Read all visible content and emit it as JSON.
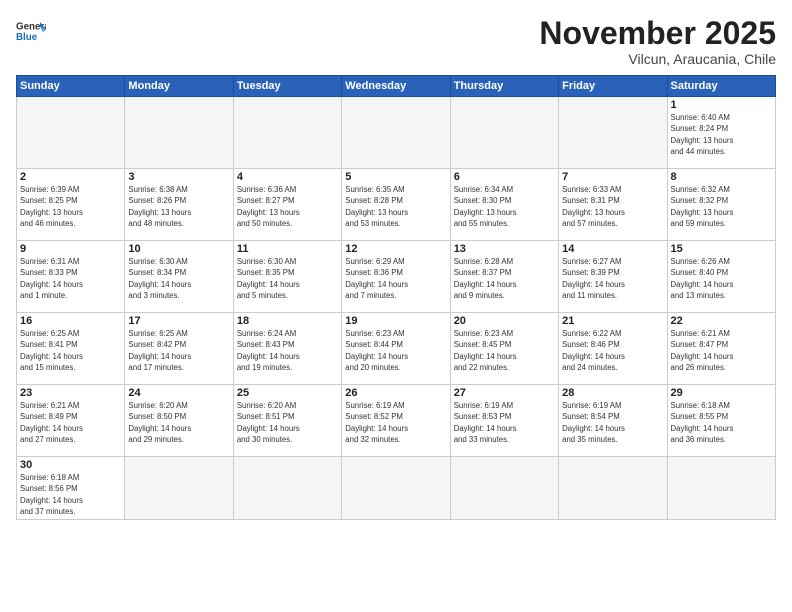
{
  "header": {
    "logo_general": "General",
    "logo_blue": "Blue",
    "month_title": "November 2025",
    "subtitle": "Vilcun, Araucania, Chile"
  },
  "weekdays": [
    "Sunday",
    "Monday",
    "Tuesday",
    "Wednesday",
    "Thursday",
    "Friday",
    "Saturday"
  ],
  "weeks": [
    [
      {
        "day": "",
        "info": ""
      },
      {
        "day": "",
        "info": ""
      },
      {
        "day": "",
        "info": ""
      },
      {
        "day": "",
        "info": ""
      },
      {
        "day": "",
        "info": ""
      },
      {
        "day": "",
        "info": ""
      },
      {
        "day": "1",
        "info": "Sunrise: 6:40 AM\nSunset: 8:24 PM\nDaylight: 13 hours\nand 44 minutes."
      }
    ],
    [
      {
        "day": "2",
        "info": "Sunrise: 6:39 AM\nSunset: 8:25 PM\nDaylight: 13 hours\nand 46 minutes."
      },
      {
        "day": "3",
        "info": "Sunrise: 6:38 AM\nSunset: 8:26 PM\nDaylight: 13 hours\nand 48 minutes."
      },
      {
        "day": "4",
        "info": "Sunrise: 6:36 AM\nSunset: 8:27 PM\nDaylight: 13 hours\nand 50 minutes."
      },
      {
        "day": "5",
        "info": "Sunrise: 6:35 AM\nSunset: 8:28 PM\nDaylight: 13 hours\nand 53 minutes."
      },
      {
        "day": "6",
        "info": "Sunrise: 6:34 AM\nSunset: 8:30 PM\nDaylight: 13 hours\nand 55 minutes."
      },
      {
        "day": "7",
        "info": "Sunrise: 6:33 AM\nSunset: 8:31 PM\nDaylight: 13 hours\nand 57 minutes."
      },
      {
        "day": "8",
        "info": "Sunrise: 6:32 AM\nSunset: 8:32 PM\nDaylight: 13 hours\nand 59 minutes."
      }
    ],
    [
      {
        "day": "9",
        "info": "Sunrise: 6:31 AM\nSunset: 8:33 PM\nDaylight: 14 hours\nand 1 minute."
      },
      {
        "day": "10",
        "info": "Sunrise: 6:30 AM\nSunset: 8:34 PM\nDaylight: 14 hours\nand 3 minutes."
      },
      {
        "day": "11",
        "info": "Sunrise: 6:30 AM\nSunset: 8:35 PM\nDaylight: 14 hours\nand 5 minutes."
      },
      {
        "day": "12",
        "info": "Sunrise: 6:29 AM\nSunset: 8:36 PM\nDaylight: 14 hours\nand 7 minutes."
      },
      {
        "day": "13",
        "info": "Sunrise: 6:28 AM\nSunset: 8:37 PM\nDaylight: 14 hours\nand 9 minutes."
      },
      {
        "day": "14",
        "info": "Sunrise: 6:27 AM\nSunset: 8:39 PM\nDaylight: 14 hours\nand 11 minutes."
      },
      {
        "day": "15",
        "info": "Sunrise: 6:26 AM\nSunset: 8:40 PM\nDaylight: 14 hours\nand 13 minutes."
      }
    ],
    [
      {
        "day": "16",
        "info": "Sunrise: 6:25 AM\nSunset: 8:41 PM\nDaylight: 14 hours\nand 15 minutes."
      },
      {
        "day": "17",
        "info": "Sunrise: 6:25 AM\nSunset: 8:42 PM\nDaylight: 14 hours\nand 17 minutes."
      },
      {
        "day": "18",
        "info": "Sunrise: 6:24 AM\nSunset: 8:43 PM\nDaylight: 14 hours\nand 19 minutes."
      },
      {
        "day": "19",
        "info": "Sunrise: 6:23 AM\nSunset: 8:44 PM\nDaylight: 14 hours\nand 20 minutes."
      },
      {
        "day": "20",
        "info": "Sunrise: 6:23 AM\nSunset: 8:45 PM\nDaylight: 14 hours\nand 22 minutes."
      },
      {
        "day": "21",
        "info": "Sunrise: 6:22 AM\nSunset: 8:46 PM\nDaylight: 14 hours\nand 24 minutes."
      },
      {
        "day": "22",
        "info": "Sunrise: 6:21 AM\nSunset: 8:47 PM\nDaylight: 14 hours\nand 26 minutes."
      }
    ],
    [
      {
        "day": "23",
        "info": "Sunrise: 6:21 AM\nSunset: 8:49 PM\nDaylight: 14 hours\nand 27 minutes."
      },
      {
        "day": "24",
        "info": "Sunrise: 6:20 AM\nSunset: 8:50 PM\nDaylight: 14 hours\nand 29 minutes."
      },
      {
        "day": "25",
        "info": "Sunrise: 6:20 AM\nSunset: 8:51 PM\nDaylight: 14 hours\nand 30 minutes."
      },
      {
        "day": "26",
        "info": "Sunrise: 6:19 AM\nSunset: 8:52 PM\nDaylight: 14 hours\nand 32 minutes."
      },
      {
        "day": "27",
        "info": "Sunrise: 6:19 AM\nSunset: 8:53 PM\nDaylight: 14 hours\nand 33 minutes."
      },
      {
        "day": "28",
        "info": "Sunrise: 6:19 AM\nSunset: 8:54 PM\nDaylight: 14 hours\nand 35 minutes."
      },
      {
        "day": "29",
        "info": "Sunrise: 6:18 AM\nSunset: 8:55 PM\nDaylight: 14 hours\nand 36 minutes."
      }
    ],
    [
      {
        "day": "30",
        "info": "Sunrise: 6:18 AM\nSunset: 8:56 PM\nDaylight: 14 hours\nand 37 minutes."
      },
      {
        "day": "",
        "info": ""
      },
      {
        "day": "",
        "info": ""
      },
      {
        "day": "",
        "info": ""
      },
      {
        "day": "",
        "info": ""
      },
      {
        "day": "",
        "info": ""
      },
      {
        "day": "",
        "info": ""
      }
    ]
  ]
}
